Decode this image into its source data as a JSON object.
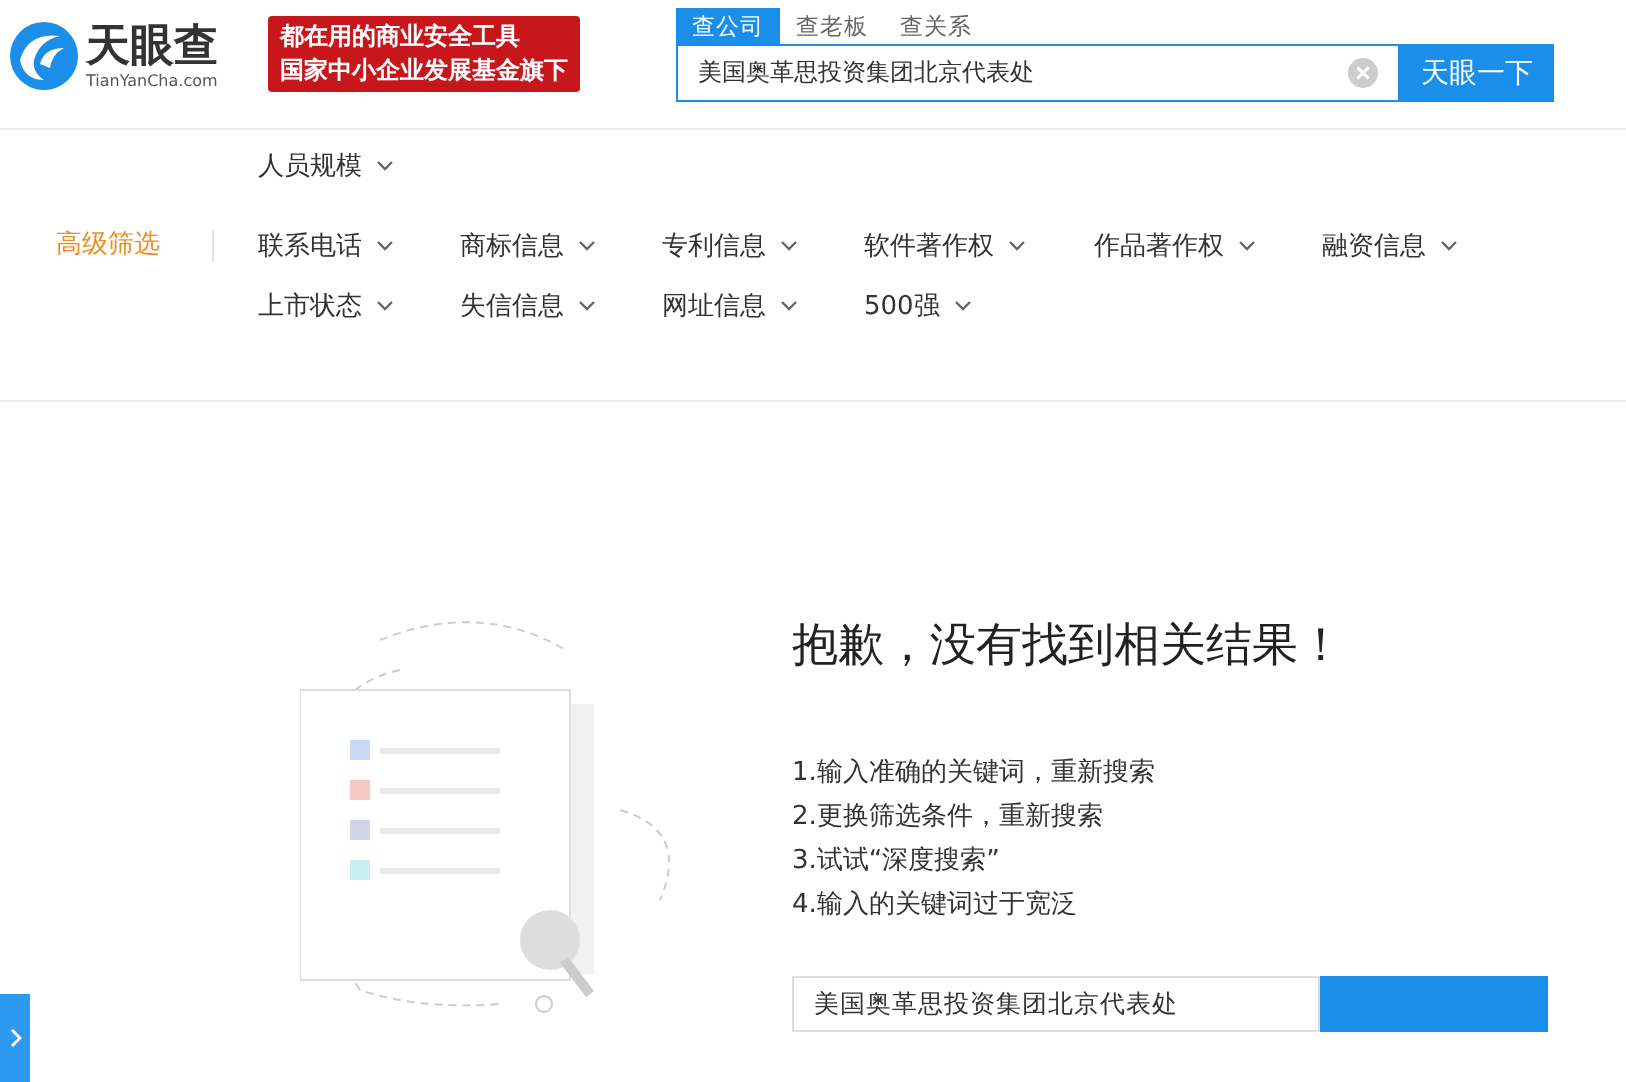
{
  "logo": {
    "name": "天眼查",
    "domain": "TianYanCha.com"
  },
  "slogan": {
    "line1": "都在用的商业安全工具",
    "line2": "国家中小企业发展基金旗下"
  },
  "search": {
    "tabs": [
      {
        "label": "查公司",
        "selected": true
      },
      {
        "label": "查老板",
        "selected": false
      },
      {
        "label": "查关系",
        "selected": false
      }
    ],
    "value": "美国奥革思投资集团北京代表处",
    "button": "天眼一下"
  },
  "filters": {
    "top_item": "人员规模",
    "label": "高级筛选",
    "rows": [
      [
        "联系电话",
        "商标信息",
        "专利信息",
        "软件著作权",
        "作品著作权",
        "融资信息"
      ],
      [
        "上市状态",
        "失信信息",
        "网址信息",
        "500强"
      ]
    ]
  },
  "empty": {
    "title": "抱歉，没有找到相关结果！",
    "tips": [
      "1.输入准确的关键词，重新搜索",
      "2.更换筛选条件，重新搜索",
      "3.试试“深度搜索”",
      "4.输入的关键词过于宽泛"
    ],
    "value": "美国奥革思投资集团北京代表处"
  }
}
